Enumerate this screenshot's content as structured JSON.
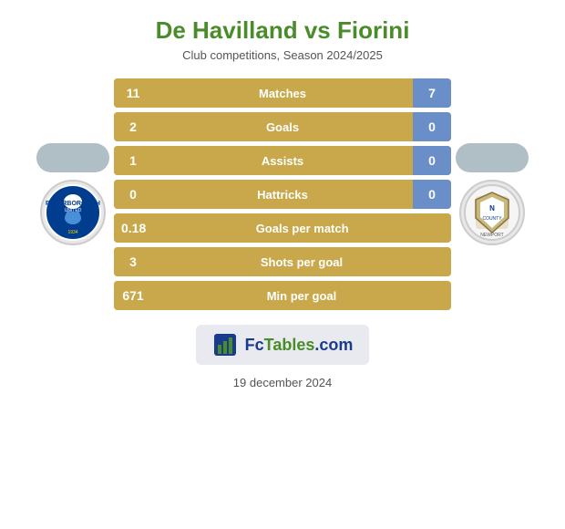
{
  "header": {
    "title": "De Havilland vs Fiorini",
    "subtitle": "Club competitions, Season 2024/2025"
  },
  "stats": [
    {
      "id": "matches",
      "label": "Matches",
      "left": "11",
      "right": "7",
      "has_right": true
    },
    {
      "id": "goals",
      "label": "Goals",
      "left": "2",
      "right": "0",
      "has_right": true
    },
    {
      "id": "assists",
      "label": "Assists",
      "left": "1",
      "right": "0",
      "has_right": true
    },
    {
      "id": "hattricks",
      "label": "Hattricks",
      "left": "0",
      "right": "0",
      "has_right": true
    },
    {
      "id": "goals-per-match",
      "label": "Goals per match",
      "left": "0.18",
      "right": null,
      "has_right": false
    },
    {
      "id": "shots-per-goal",
      "label": "Shots per goal",
      "left": "3",
      "right": null,
      "has_right": false
    },
    {
      "id": "min-per-goal",
      "label": "Min per goal",
      "left": "671",
      "right": null,
      "has_right": false
    }
  ],
  "logo": {
    "text": "FcTables.com"
  },
  "footer": {
    "date": "19 december 2024"
  }
}
